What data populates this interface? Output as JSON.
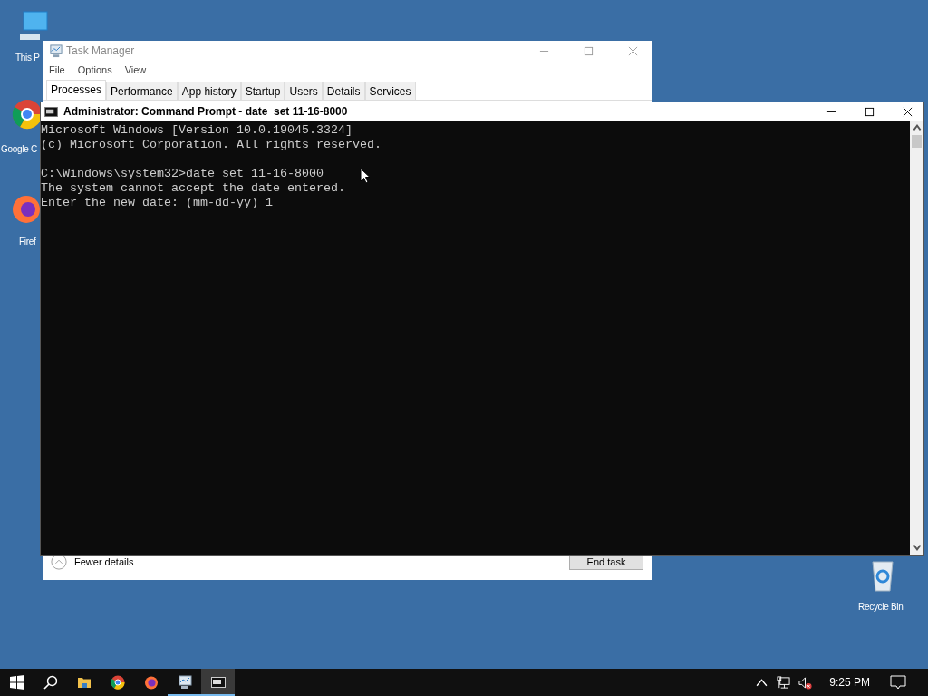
{
  "desktop_icons": [
    {
      "kind": "pc",
      "label": "This P"
    },
    {
      "kind": "chrome",
      "label": "Google C"
    },
    {
      "kind": "firefox",
      "label": "Firef"
    },
    {
      "kind": "recycle",
      "label": "Recycle Bin"
    }
  ],
  "task_manager": {
    "title": "Task Manager",
    "menu": [
      "File",
      "Options",
      "View"
    ],
    "tabs": [
      {
        "label": "Processes",
        "selected": true
      },
      {
        "label": "Performance",
        "selected": false
      },
      {
        "label": "App history",
        "selected": false
      },
      {
        "label": "Startup",
        "selected": false
      },
      {
        "label": "Users",
        "selected": false
      },
      {
        "label": "Details",
        "selected": false
      },
      {
        "label": "Services",
        "selected": false
      }
    ],
    "fewer_details": "Fewer details",
    "end_task": "End task"
  },
  "command_prompt": {
    "title": "Administrator: Command Prompt - date  set 11-16-8000",
    "blocks": [
      [
        "Microsoft Windows [Version 10.0.19045.3324]",
        "(c) Microsoft Corporation. All rights reserved."
      ],
      [
        "C:\\Windows\\system32>date set 11-16-8000",
        "The system cannot accept the date entered.",
        "Enter the new date: (mm-dd-yy) 1"
      ]
    ]
  },
  "taskbar": {
    "apps": [
      {
        "kind": "start",
        "running": false,
        "selected": false
      },
      {
        "kind": "search",
        "running": false,
        "selected": false
      },
      {
        "kind": "folder",
        "running": false,
        "selected": false
      },
      {
        "kind": "chrome",
        "running": false,
        "selected": false
      },
      {
        "kind": "firefox",
        "running": false,
        "selected": false
      },
      {
        "kind": "taskmgr",
        "running": true,
        "selected": false
      },
      {
        "kind": "cmd",
        "running": true,
        "selected": true
      }
    ],
    "clock": "9:25 PM"
  }
}
